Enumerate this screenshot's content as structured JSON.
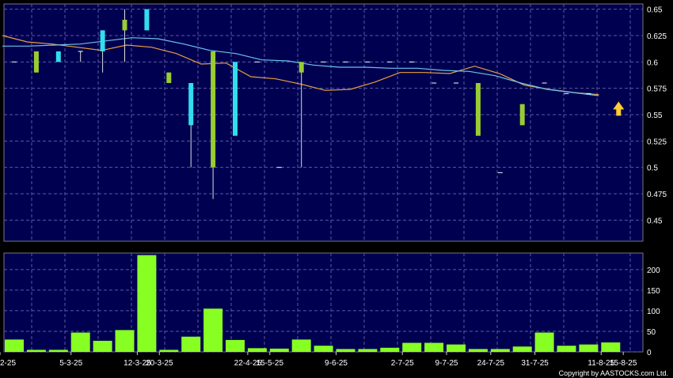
{
  "copyright": "Copyright by AASTOCKS.com Ltd.",
  "chart_data": [
    {
      "type": "candlestick",
      "ylim": [
        0.43,
        0.655
      ],
      "yticks": [
        0.45,
        0.475,
        0.5,
        0.525,
        0.55,
        0.575,
        0.6,
        0.625,
        0.65
      ],
      "ytick_labels": [
        "0.45",
        "0.475",
        "0.5",
        "0.525",
        "0.55",
        "0.575",
        "0.6",
        "0.625",
        "0.65"
      ],
      "background": "#000050",
      "up_color": "#33ddee",
      "down_color": "#99cc33",
      "flat_color": "#ffffff",
      "grid": true,
      "candles": [
        {
          "o": 0.6,
          "h": 0.6,
          "l": 0.6,
          "c": 0.6
        },
        {
          "o": 0.61,
          "h": 0.61,
          "l": 0.59,
          "c": 0.59
        },
        {
          "o": 0.61,
          "h": 0.61,
          "l": 0.6,
          "c": 0.6
        },
        {
          "o": 0.61,
          "h": 0.61,
          "l": 0.6,
          "c": 0.61
        },
        {
          "o": 0.63,
          "h": 0.63,
          "l": 0.59,
          "c": 0.61
        },
        {
          "o": 0.63,
          "h": 0.65,
          "l": 0.6,
          "c": 0.64
        },
        {
          "o": 0.65,
          "h": 0.65,
          "l": 0.63,
          "c": 0.63
        },
        {
          "o": 0.59,
          "h": 0.59,
          "l": 0.58,
          "c": 0.58
        },
        {
          "o": 0.58,
          "h": 0.58,
          "l": 0.5,
          "c": 0.54
        },
        {
          "o": 0.61,
          "h": 0.61,
          "l": 0.47,
          "c": 0.5
        },
        {
          "o": 0.6,
          "h": 0.6,
          "l": 0.53,
          "c": 0.53
        },
        {
          "o": 0.6,
          "h": 0.6,
          "l": 0.6,
          "c": 0.6
        },
        {
          "o": 0.5,
          "h": 0.5,
          "l": 0.5,
          "c": 0.5
        },
        {
          "o": 0.6,
          "h": 0.6,
          "l": 0.5,
          "c": 0.59
        },
        {
          "o": 0.6,
          "h": 0.6,
          "l": 0.6,
          "c": 0.6
        },
        {
          "o": 0.6,
          "h": 0.6,
          "l": 0.6,
          "c": 0.6
        },
        {
          "o": 0.6,
          "h": 0.6,
          "l": 0.6,
          "c": 0.6
        },
        {
          "o": 0.6,
          "h": 0.6,
          "l": 0.6,
          "c": 0.6
        },
        {
          "o": 0.6,
          "h": 0.6,
          "l": 0.6,
          "c": 0.6
        },
        {
          "o": 0.58,
          "h": 0.58,
          "l": 0.58,
          "c": 0.58
        },
        {
          "o": 0.58,
          "h": 0.58,
          "l": 0.58,
          "c": 0.58
        },
        {
          "o": 0.58,
          "h": 0.58,
          "l": 0.53,
          "c": 0.53
        },
        {
          "o": 0.495,
          "h": 0.495,
          "l": 0.495,
          "c": 0.495
        },
        {
          "o": 0.56,
          "h": 0.56,
          "l": 0.54,
          "c": 0.54
        },
        {
          "o": 0.58,
          "h": 0.58,
          "l": 0.58,
          "c": 0.58
        },
        {
          "o": 0.57,
          "h": 0.57,
          "l": 0.57,
          "c": 0.57
        },
        {
          "o": 0.57,
          "h": 0.57,
          "l": 0.57,
          "c": 0.57
        }
      ],
      "ma_series": [
        {
          "color": "#e8a040",
          "values": [
            0.625,
            0.619,
            0.617,
            0.614,
            0.611,
            0.616,
            0.614,
            0.608,
            0.598,
            0.599,
            0.586,
            0.584,
            0.579,
            0.573,
            0.574,
            0.581,
            0.59,
            0.59,
            0.589,
            0.596,
            0.589,
            0.578,
            0.574,
            0.571,
            0.569
          ]
        },
        {
          "color": "#6cc4ec",
          "values": [
            0.615,
            0.615,
            0.616,
            0.617,
            0.62,
            0.623,
            0.622,
            0.617,
            0.611,
            0.608,
            0.602,
            0.601,
            0.597,
            0.595,
            0.595,
            0.594,
            0.594,
            0.592,
            0.591,
            0.587,
            0.58,
            0.574,
            0.571,
            0.568
          ]
        }
      ],
      "marker": {
        "price": 0.555,
        "color": "#ffcc33"
      }
    },
    {
      "type": "bar",
      "ylim": [
        0,
        240
      ],
      "yticks": [
        0,
        50,
        100,
        150,
        200
      ],
      "ytick_labels": [
        "0",
        "50",
        "100",
        "150",
        "200"
      ],
      "bar_color": "#88ff22",
      "background": "#000050",
      "grid": true,
      "values": [
        30,
        5,
        5,
        47,
        27,
        53,
        235,
        5,
        37,
        105,
        29,
        9,
        8,
        30,
        15,
        7,
        7,
        10,
        22,
        22,
        18,
        7,
        7,
        13,
        47,
        15,
        18,
        23
      ],
      "xtick_labels": [
        "2-25",
        "5-3-25",
        "12-3-25",
        "20-3-25",
        "22-4-25",
        "15-5-25",
        "9-6-25",
        "2-7-25",
        "9-7-25",
        "24-7-25",
        "31-7-25",
        "11-8-25",
        "15-8-25"
      ],
      "xtick_bar_index": [
        0,
        3,
        6,
        7,
        11,
        12,
        15,
        18,
        20,
        22,
        24,
        27,
        28
      ]
    }
  ]
}
